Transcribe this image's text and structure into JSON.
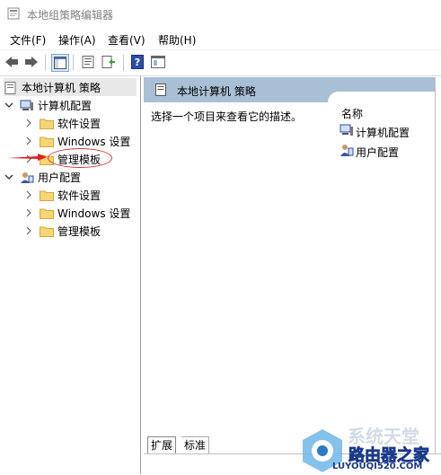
{
  "window": {
    "title": "本地组策略编辑器"
  },
  "menu": [
    "文件(F)",
    "操作(A)",
    "查看(V)",
    "帮助(H)"
  ],
  "toolbar": {
    "buttons": [
      "back-icon",
      "forward-icon",
      "console-tree-icon",
      "properties-icon",
      "export-list-icon",
      "help-icon",
      "view-icon"
    ]
  },
  "tree": {
    "root": "本地计算机 策略",
    "computer": "计算机配置",
    "computer_children": [
      "软件设置",
      "Windows 设置",
      "管理模板"
    ],
    "user": "用户配置",
    "user_children": [
      "软件设置",
      "Windows 设置",
      "管理模板"
    ]
  },
  "right": {
    "header": "本地计算机 策略",
    "description": "选择一个项目来查看它的描述。",
    "column_name": "名称",
    "items": [
      "计算机配置",
      "用户配置"
    ]
  },
  "tabs": [
    "扩展",
    "标准"
  ],
  "watermark": {
    "brand": "路由器之家",
    "ghost": "系统天堂",
    "site": "LUYOUQI520.COM"
  },
  "colors": {
    "header_bg": "#a9bfd6",
    "highlight_ellipse": "#e03030",
    "folder": "#f5d575"
  }
}
